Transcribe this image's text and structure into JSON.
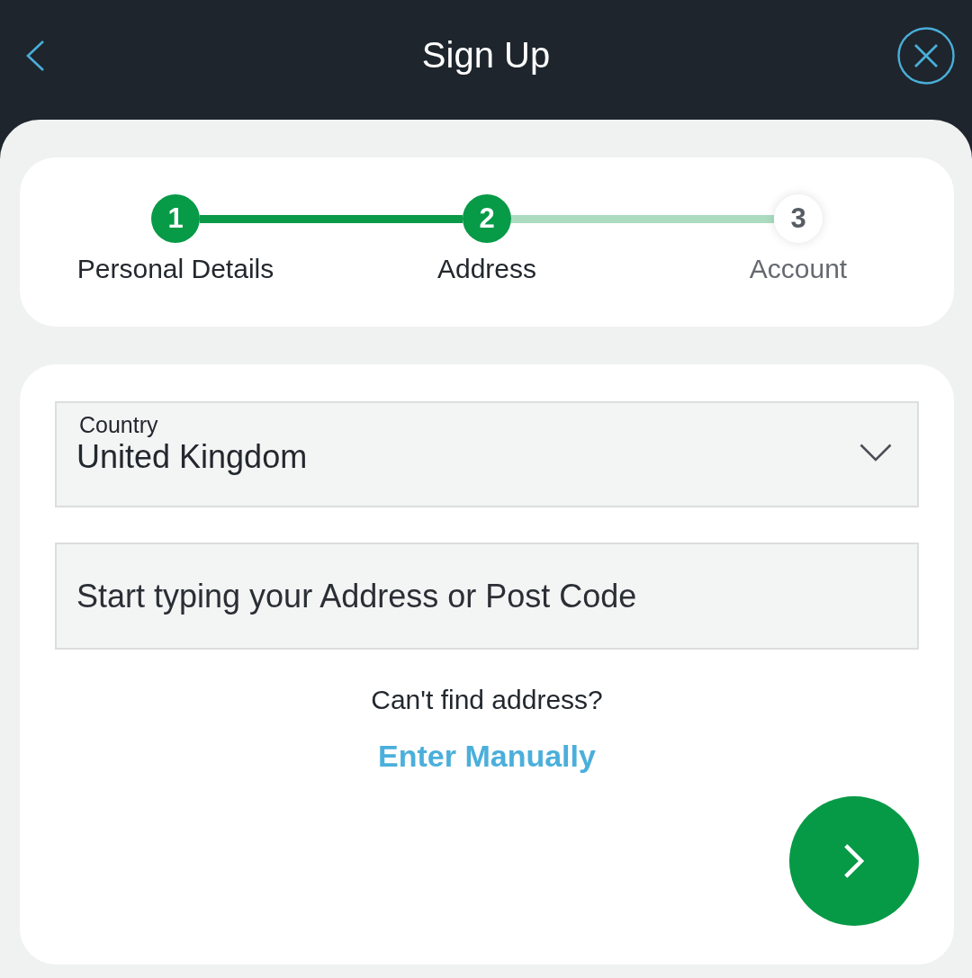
{
  "header": {
    "title": "Sign Up"
  },
  "stepper": {
    "steps": [
      {
        "number": "1",
        "label": "Personal Details",
        "active": true
      },
      {
        "number": "2",
        "label": "Address",
        "active": true
      },
      {
        "number": "3",
        "label": "Account",
        "active": false
      }
    ]
  },
  "form": {
    "country": {
      "label": "Country",
      "value": "United Kingdom"
    },
    "address": {
      "placeholder": "Start typing your Address or Post Code"
    },
    "help_text": "Can't find address?",
    "manual_link": "Enter Manually"
  }
}
